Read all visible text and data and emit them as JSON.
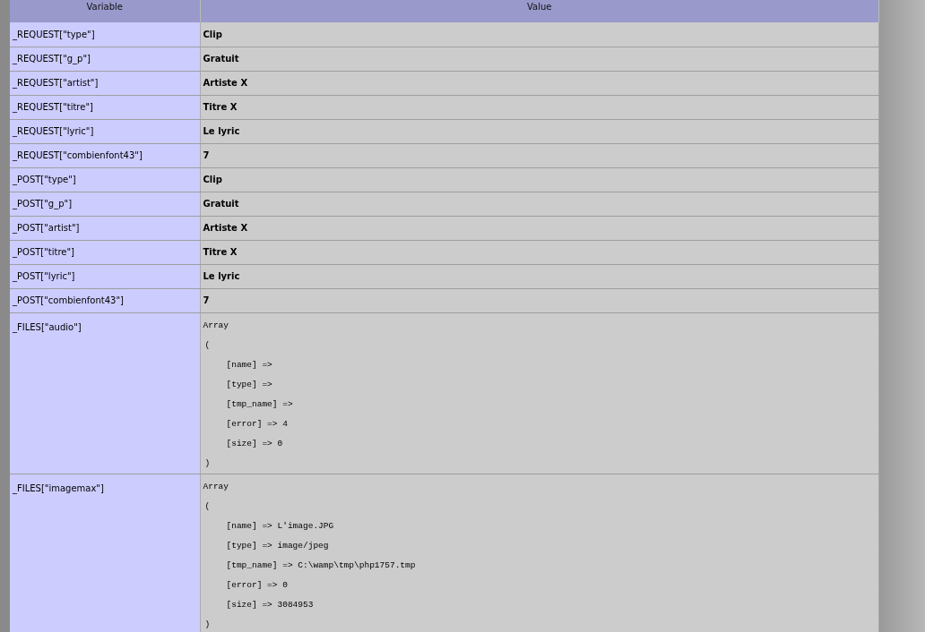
{
  "table": {
    "columns": [
      "Variable",
      "Value"
    ],
    "rows": [
      {
        "variable": "_REQUEST[\"type\"]",
        "kind": "text",
        "value": "Clip"
      },
      {
        "variable": "_REQUEST[\"g_p\"]",
        "kind": "text",
        "value": "Gratuit"
      },
      {
        "variable": "_REQUEST[\"artist\"]",
        "kind": "text",
        "value": "Artiste X"
      },
      {
        "variable": "_REQUEST[\"titre\"]",
        "kind": "text",
        "value": "Titre X"
      },
      {
        "variable": "_REQUEST[\"lyric\"]",
        "kind": "text",
        "value": "Le lyric"
      },
      {
        "variable": "_REQUEST[\"combienfont43\"]",
        "kind": "text",
        "value": "7"
      },
      {
        "variable": "_POST[\"type\"]",
        "kind": "text",
        "value": "Clip"
      },
      {
        "variable": "_POST[\"g_p\"]",
        "kind": "text",
        "value": "Gratuit"
      },
      {
        "variable": "_POST[\"artist\"]",
        "kind": "text",
        "value": "Artiste X"
      },
      {
        "variable": "_POST[\"titre\"]",
        "kind": "text",
        "value": "Titre X"
      },
      {
        "variable": "_POST[\"lyric\"]",
        "kind": "text",
        "value": "Le lyric"
      },
      {
        "variable": "_POST[\"combienfont43\"]",
        "kind": "text",
        "value": "7"
      },
      {
        "variable": "_FILES[\"audio\"]",
        "kind": "array",
        "title": "Array",
        "open": "(",
        "entries": [
          "[name] =>",
          "[type] =>",
          "[tmp_name] =>",
          "[error] => 4",
          "[size] => 0"
        ],
        "close": ")"
      },
      {
        "variable": "_FILES[\"imagemax\"]",
        "kind": "array",
        "title": "Array",
        "open": "(",
        "entries": [
          "[name] => L'image.JPG",
          "[type] => image/jpeg",
          "[tmp_name] => C:\\wamp\\tmp\\php1757.tmp",
          "[error] => 0",
          "[size] => 3084953"
        ],
        "close": ")"
      }
    ]
  }
}
